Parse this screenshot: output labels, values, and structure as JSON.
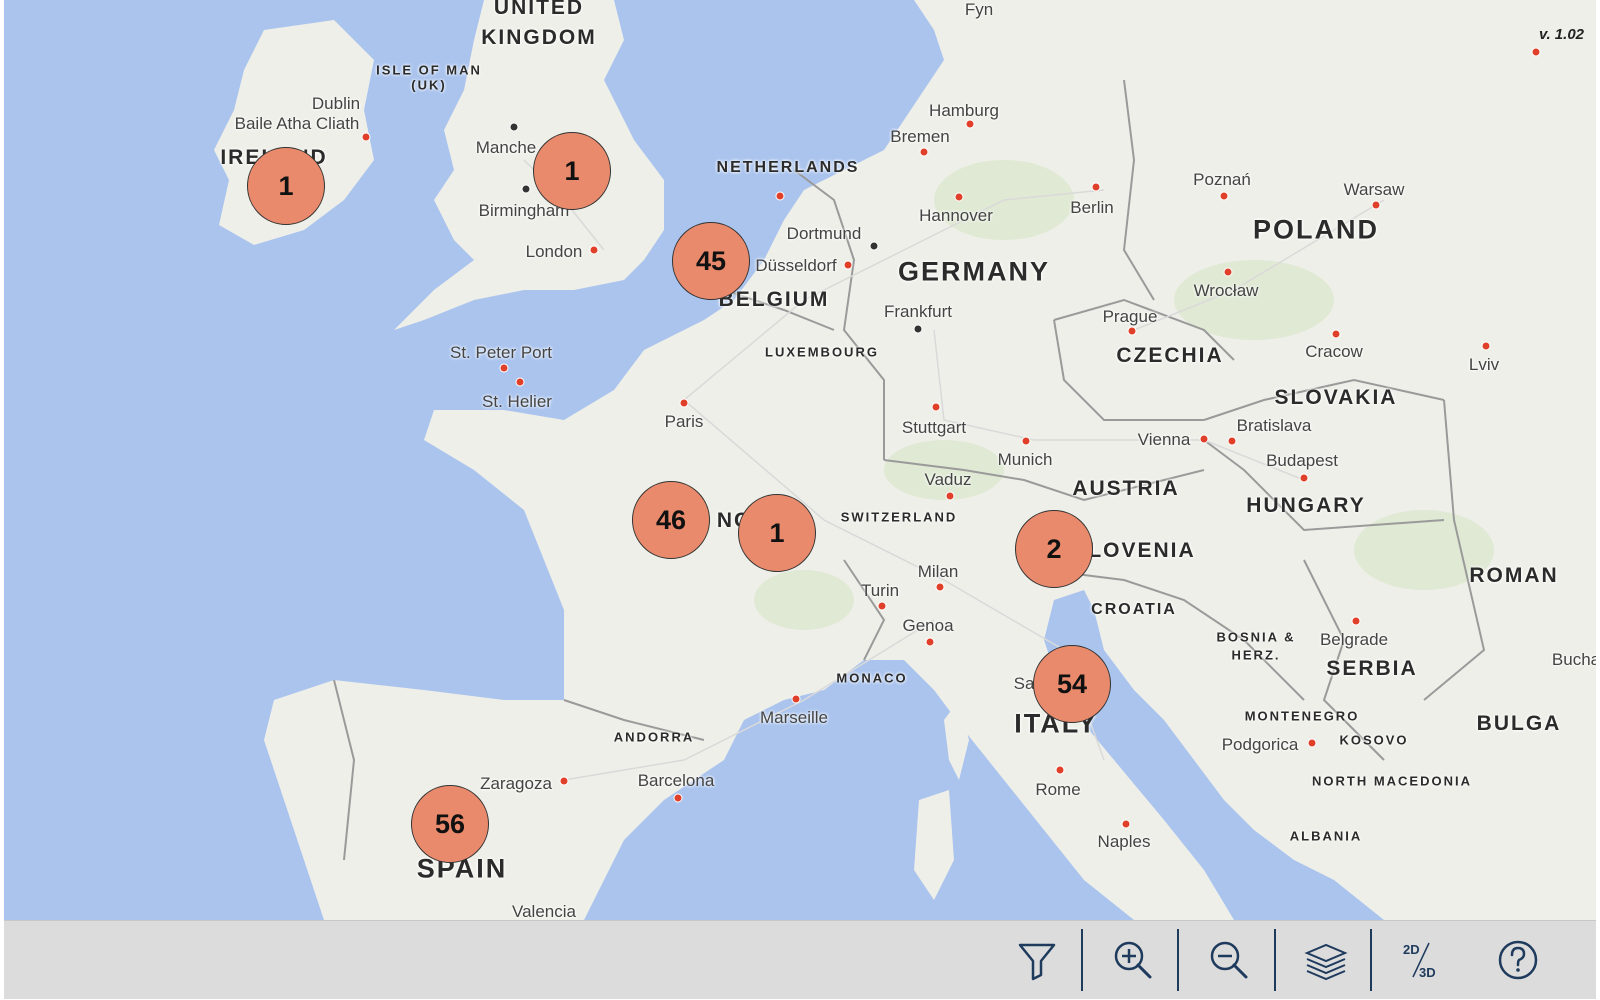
{
  "map": {
    "version": "v. 1.02",
    "countries": [
      {
        "name": "UNITED KINGDOM",
        "key": "uk"
      },
      {
        "name": "IRELAND",
        "key": "ie"
      },
      {
        "name": "ISLE OF MAN (UK)",
        "key": "iom"
      },
      {
        "name": "NETHERLANDS",
        "key": "nl"
      },
      {
        "name": "BELGIUM",
        "key": "be"
      },
      {
        "name": "LUXEMBOURG",
        "key": "lu"
      },
      {
        "name": "GERMANY",
        "key": "de"
      },
      {
        "name": "POLAND",
        "key": "pl"
      },
      {
        "name": "CZECHIA",
        "key": "cz"
      },
      {
        "name": "SLOVAKIA",
        "key": "sk"
      },
      {
        "name": "AUSTRIA",
        "key": "at"
      },
      {
        "name": "HUNGARY",
        "key": "hu"
      },
      {
        "name": "SWITZERLAND",
        "key": "ch"
      },
      {
        "name": "SLOVENIA",
        "key": "si"
      },
      {
        "name": "CROATIA",
        "key": "hr"
      },
      {
        "name": "BOSNIA & HERZ.",
        "key": "ba"
      },
      {
        "name": "SERBIA",
        "key": "rs"
      },
      {
        "name": "MONTENEGRO",
        "key": "me"
      },
      {
        "name": "KOSOVO",
        "key": "xk"
      },
      {
        "name": "NORTH MACEDONIA",
        "key": "mk"
      },
      {
        "name": "ALBANIA",
        "key": "al"
      },
      {
        "name": "ROMANIA",
        "key": "ro"
      },
      {
        "name": "BULGARIA",
        "key": "bg"
      },
      {
        "name": "FRANCE",
        "key": "fr"
      },
      {
        "name": "MONACO",
        "key": "mc"
      },
      {
        "name": "ANDORRA",
        "key": "ad"
      },
      {
        "name": "ITALY",
        "key": "it"
      },
      {
        "name": "SPAIN",
        "key": "es"
      }
    ],
    "cities": [
      "Dublin",
      "Baile Atha Cliath",
      "Manchester",
      "Birmingham",
      "London",
      "Hamburg",
      "Bremen",
      "Hannover",
      "Berlin",
      "Dortmund",
      "Düsseldorf",
      "Frankfurt",
      "Poznań",
      "Warsaw",
      "Wrocław",
      "Prague",
      "Cracow",
      "Lviv",
      "St. Peter Port",
      "St. Helier",
      "Paris",
      "Stuttgart",
      "Munich",
      "Vienna",
      "Bratislava",
      "Budapest",
      "Vaduz",
      "Milan",
      "Turin",
      "Genoa",
      "Marseille",
      "Zaragoza",
      "Barcelona",
      "Rome",
      "Naples",
      "Belgrade",
      "Podgorica",
      "Bucharest",
      "Valencia",
      "Fyn",
      "San Marino"
    ],
    "clusters": [
      {
        "id": "ireland",
        "count": "1"
      },
      {
        "id": "uk",
        "count": "1"
      },
      {
        "id": "belgium",
        "count": "45"
      },
      {
        "id": "france-west",
        "count": "46"
      },
      {
        "id": "france-east",
        "count": "1"
      },
      {
        "id": "slovenia",
        "count": "2"
      },
      {
        "id": "italy",
        "count": "54"
      },
      {
        "id": "spain",
        "count": "56"
      }
    ]
  },
  "toolbar": {
    "buttons": [
      {
        "id": "filter",
        "icon": "filter-icon"
      },
      {
        "id": "zoom-in",
        "icon": "zoom-in-icon"
      },
      {
        "id": "zoom-out",
        "icon": "zoom-out-icon"
      },
      {
        "id": "layers",
        "icon": "layers-icon"
      },
      {
        "id": "view-mode",
        "icon": "2d-3d-icon",
        "label_2d": "2D",
        "label_3d": "3D"
      },
      {
        "id": "help",
        "icon": "help-icon"
      }
    ]
  },
  "colors": {
    "water": "#aac4ee",
    "land": "#efefe9",
    "cluster_fill": "#e98a6c",
    "toolbar_bg": "#dcdcdc",
    "icon": "#1e3a5c"
  }
}
